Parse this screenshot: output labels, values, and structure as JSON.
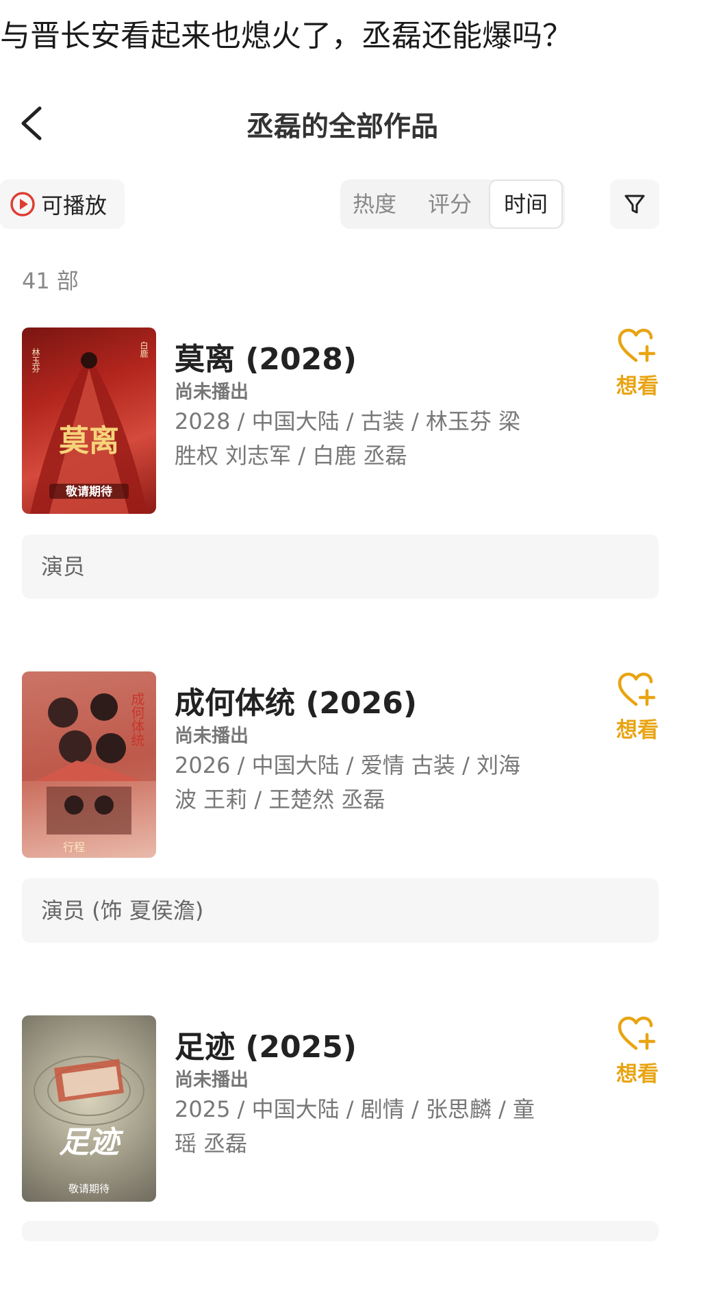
{
  "post_title": "与晋长安看起来也熄火了，丞磊还能爆吗？",
  "nav": {
    "title": "丞磊的全部作品"
  },
  "filters": {
    "playable_label": "可播放",
    "sort_tabs": [
      "热度",
      "评分",
      "时间"
    ],
    "active_sort": "时间"
  },
  "count_text": "41 部",
  "works": [
    {
      "title": "莫离 (2028)",
      "status": "尚未播出",
      "meta": "2028 / 中国大陆 / 古装 / 林玉芬 梁胜权 刘志军 / 白鹿 丞磊",
      "role": "演员",
      "want_label": "想看",
      "poster": {
        "big_text": "莫离",
        "footer_text": "敬请期待",
        "top_left": "林玉芬",
        "top_right": "白鹿",
        "colors": [
          "#b3261e",
          "#e0584a"
        ]
      }
    },
    {
      "title": "成何体统 (2026)",
      "status": "尚未播出",
      "meta": "2026 / 中国大陆 / 爱情 古装 / 刘海波 王莉 / 王楚然 丞磊",
      "role": "演员 (饰 夏侯澹)",
      "want_label": "想看",
      "poster": {
        "big_text": "成何体统",
        "footer_text": "行程",
        "colors": [
          "#c96a5a",
          "#f0b7a6"
        ]
      }
    },
    {
      "title": "足迹 (2025)",
      "status": "尚未播出",
      "meta": "2025 / 中国大陆 / 剧情 / 张思麟 / 童瑶 丞磊",
      "role": "",
      "want_label": "想看",
      "poster": {
        "big_text": "足迹",
        "footer_text": "敬请期待",
        "colors": [
          "#7d7a6c",
          "#c9c2a8"
        ]
      }
    }
  ]
}
